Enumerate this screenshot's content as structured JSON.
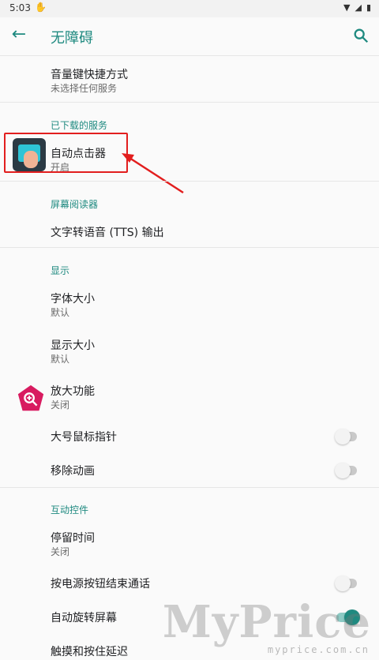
{
  "status_bar": {
    "time": "5:03"
  },
  "app_bar": {
    "title": "无障碍"
  },
  "sections": {
    "volume_shortcut": {
      "title": "音量键快捷方式",
      "subtitle": "未选择任何服务"
    },
    "downloaded_header": "已下载的服务",
    "auto_clicker": {
      "title": "自动点击器",
      "subtitle": "开启"
    },
    "screen_reader_header": "屏幕阅读器",
    "tts": {
      "title": "文字转语音 (TTS) 输出"
    },
    "display_header": "显示",
    "font_size": {
      "title": "字体大小",
      "subtitle": "默认"
    },
    "display_size": {
      "title": "显示大小",
      "subtitle": "默认"
    },
    "magnification": {
      "title": "放大功能",
      "subtitle": "关闭"
    },
    "large_pointer": {
      "title": "大号鼠标指针",
      "toggle": false
    },
    "remove_animations": {
      "title": "移除动画",
      "toggle": false
    },
    "interaction_header": "互动控件",
    "dwell_time": {
      "title": "停留时间",
      "subtitle": "关闭"
    },
    "power_ends_call": {
      "title": "按电源按钮结束通话",
      "toggle": false
    },
    "auto_rotate": {
      "title": "自动旋转屏幕",
      "toggle": true
    },
    "touch_delay": {
      "title": "触摸和按住延迟"
    }
  },
  "watermark": {
    "text": "MyPrice",
    "url": "myprice.com.cn"
  },
  "colors": {
    "accent": "#1f8a80",
    "highlight": "#e21e1e"
  }
}
